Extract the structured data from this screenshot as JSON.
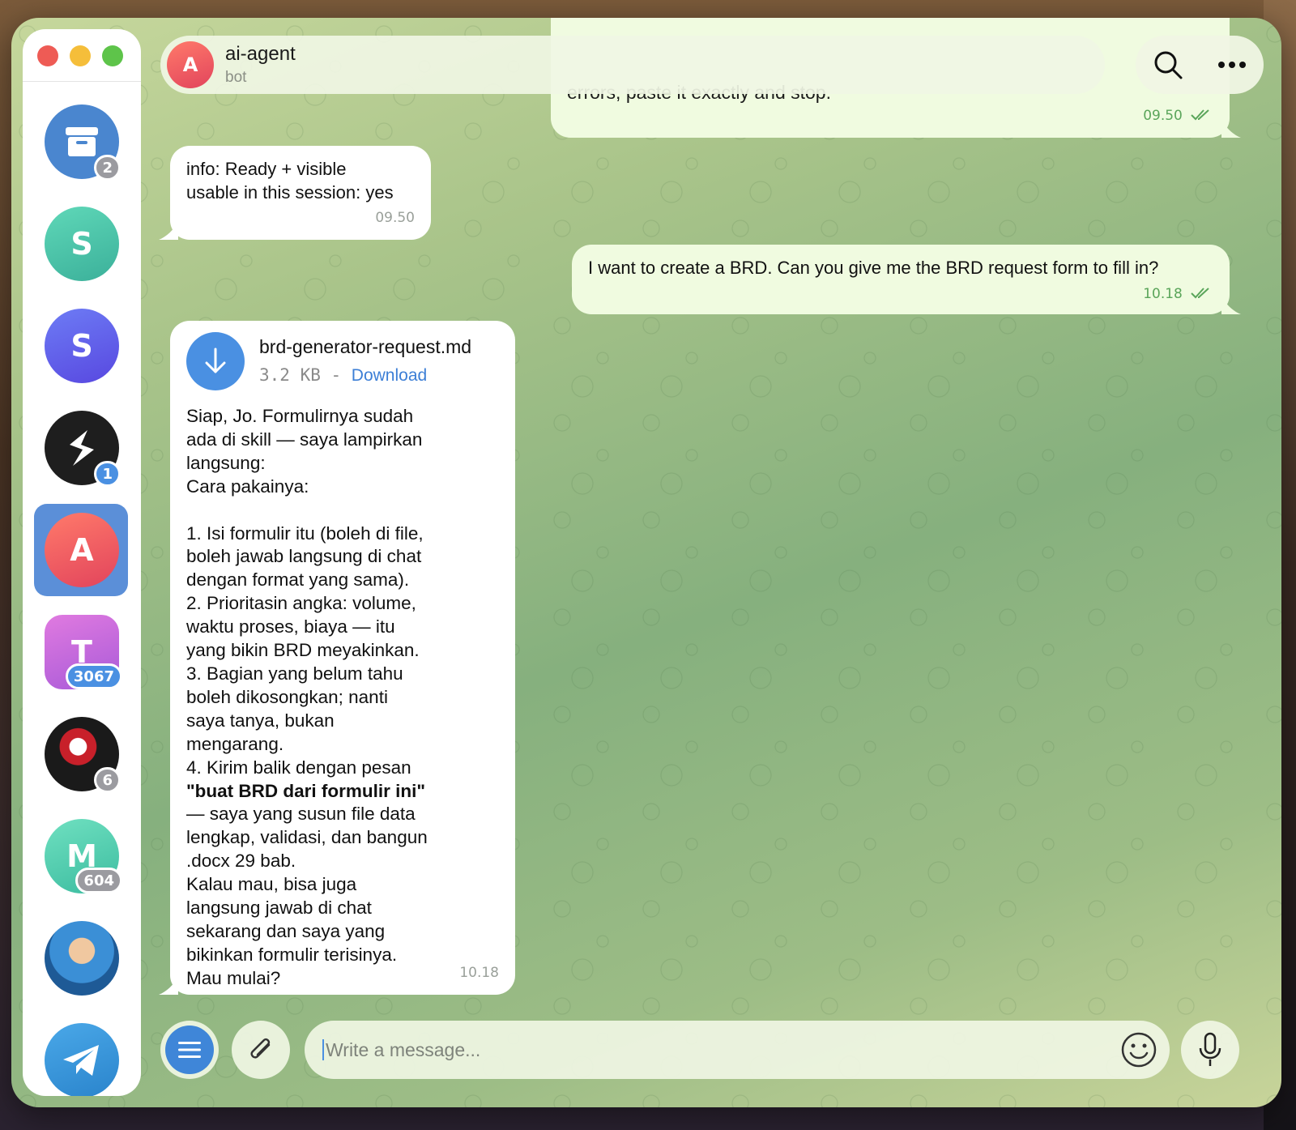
{
  "window": {
    "title": "ai-agent"
  },
  "sidebar": {
    "items": [
      {
        "label": "",
        "badge": "2",
        "color": "#4a86cf",
        "icon": "archive-icon"
      },
      {
        "label": "S",
        "badge": "",
        "color": "#4cc2a8"
      },
      {
        "label": "S",
        "badge": "",
        "color": "#5b63e8"
      },
      {
        "label": "",
        "badge": "1",
        "color": "#1e1e1e",
        "icon": "s-logo-icon"
      },
      {
        "label": "A",
        "badge": "",
        "color": "#ea5a5a",
        "active": true
      },
      {
        "label": "T",
        "badge": "3067",
        "color": "#c06ad8"
      },
      {
        "label": "",
        "badge": "6",
        "color": "#1a1a1a",
        "icon": "fist-image"
      },
      {
        "label": "M",
        "badge": "604",
        "color": "#4ccaa6"
      },
      {
        "label": "",
        "badge": "",
        "color": "#3b8fd6",
        "icon": "person-image"
      },
      {
        "label": "",
        "badge": "",
        "color": "#3a8ed8",
        "icon": "telegram-icon"
      }
    ]
  },
  "header": {
    "avatar_letter": "A",
    "name": "ai-agent",
    "subtitle": "bot"
  },
  "messages": [
    {
      "direction": "out",
      "text": "view, without running anything else: can you see and use the brd-drafter\nskill in this session, ...\nreinstall, do not restart the gateway, do not edit any files. If the command\nerrors, paste it exactly and stop.",
      "visible_tail": "errors, paste it exactly and stop.",
      "time": "09.50",
      "read": true
    },
    {
      "direction": "in",
      "text": "info: Ready + visible\nusable in this session: yes",
      "time": "09.50"
    },
    {
      "direction": "out",
      "text": "I want to create a BRD. Can you give me the BRD request form to fill in?",
      "time": "10.18",
      "read": true
    },
    {
      "direction": "in",
      "file": {
        "name": "brd-generator-request.md",
        "size": "3.2 KB",
        "separator": " - ",
        "action": "Download"
      },
      "text_before_bold": "Siap, Jo. Formulirnya sudah\nada di skill — saya lampirkan\nlangsung:\nCara pakainya:\n\n1. Isi formulir itu (boleh di file,\nboleh jawab langsung di chat\ndengan format yang sama).\n2. Prioritasin angka: volume,\nwaktu proses, biaya — itu\nyang bikin BRD meyakinkan.\n3. Bagian yang belum tahu\nboleh dikosongkan; nanti\nsaya tanya, bukan\nmengarang.\n4. Kirim balik dengan pesan",
      "bold": "\"buat BRD dari formulir ini\"",
      "text_after_bold": "— saya yang susun file data\nlengkap, validasi, dan bangun\n.docx 29 bab.\nKalau mau, bisa juga\nlangsung jawab di chat\nsekarang dan saya yang\nbikinkan formulir terisinya.\nMau mulai?",
      "time": "10.18"
    }
  ],
  "composer": {
    "placeholder": "Write a message..."
  },
  "colors": {
    "accent": "#4a90e2",
    "out_bubble": "#f0fbe0",
    "in_bubble": "#ffffff",
    "read_check": "#5aa55a"
  }
}
